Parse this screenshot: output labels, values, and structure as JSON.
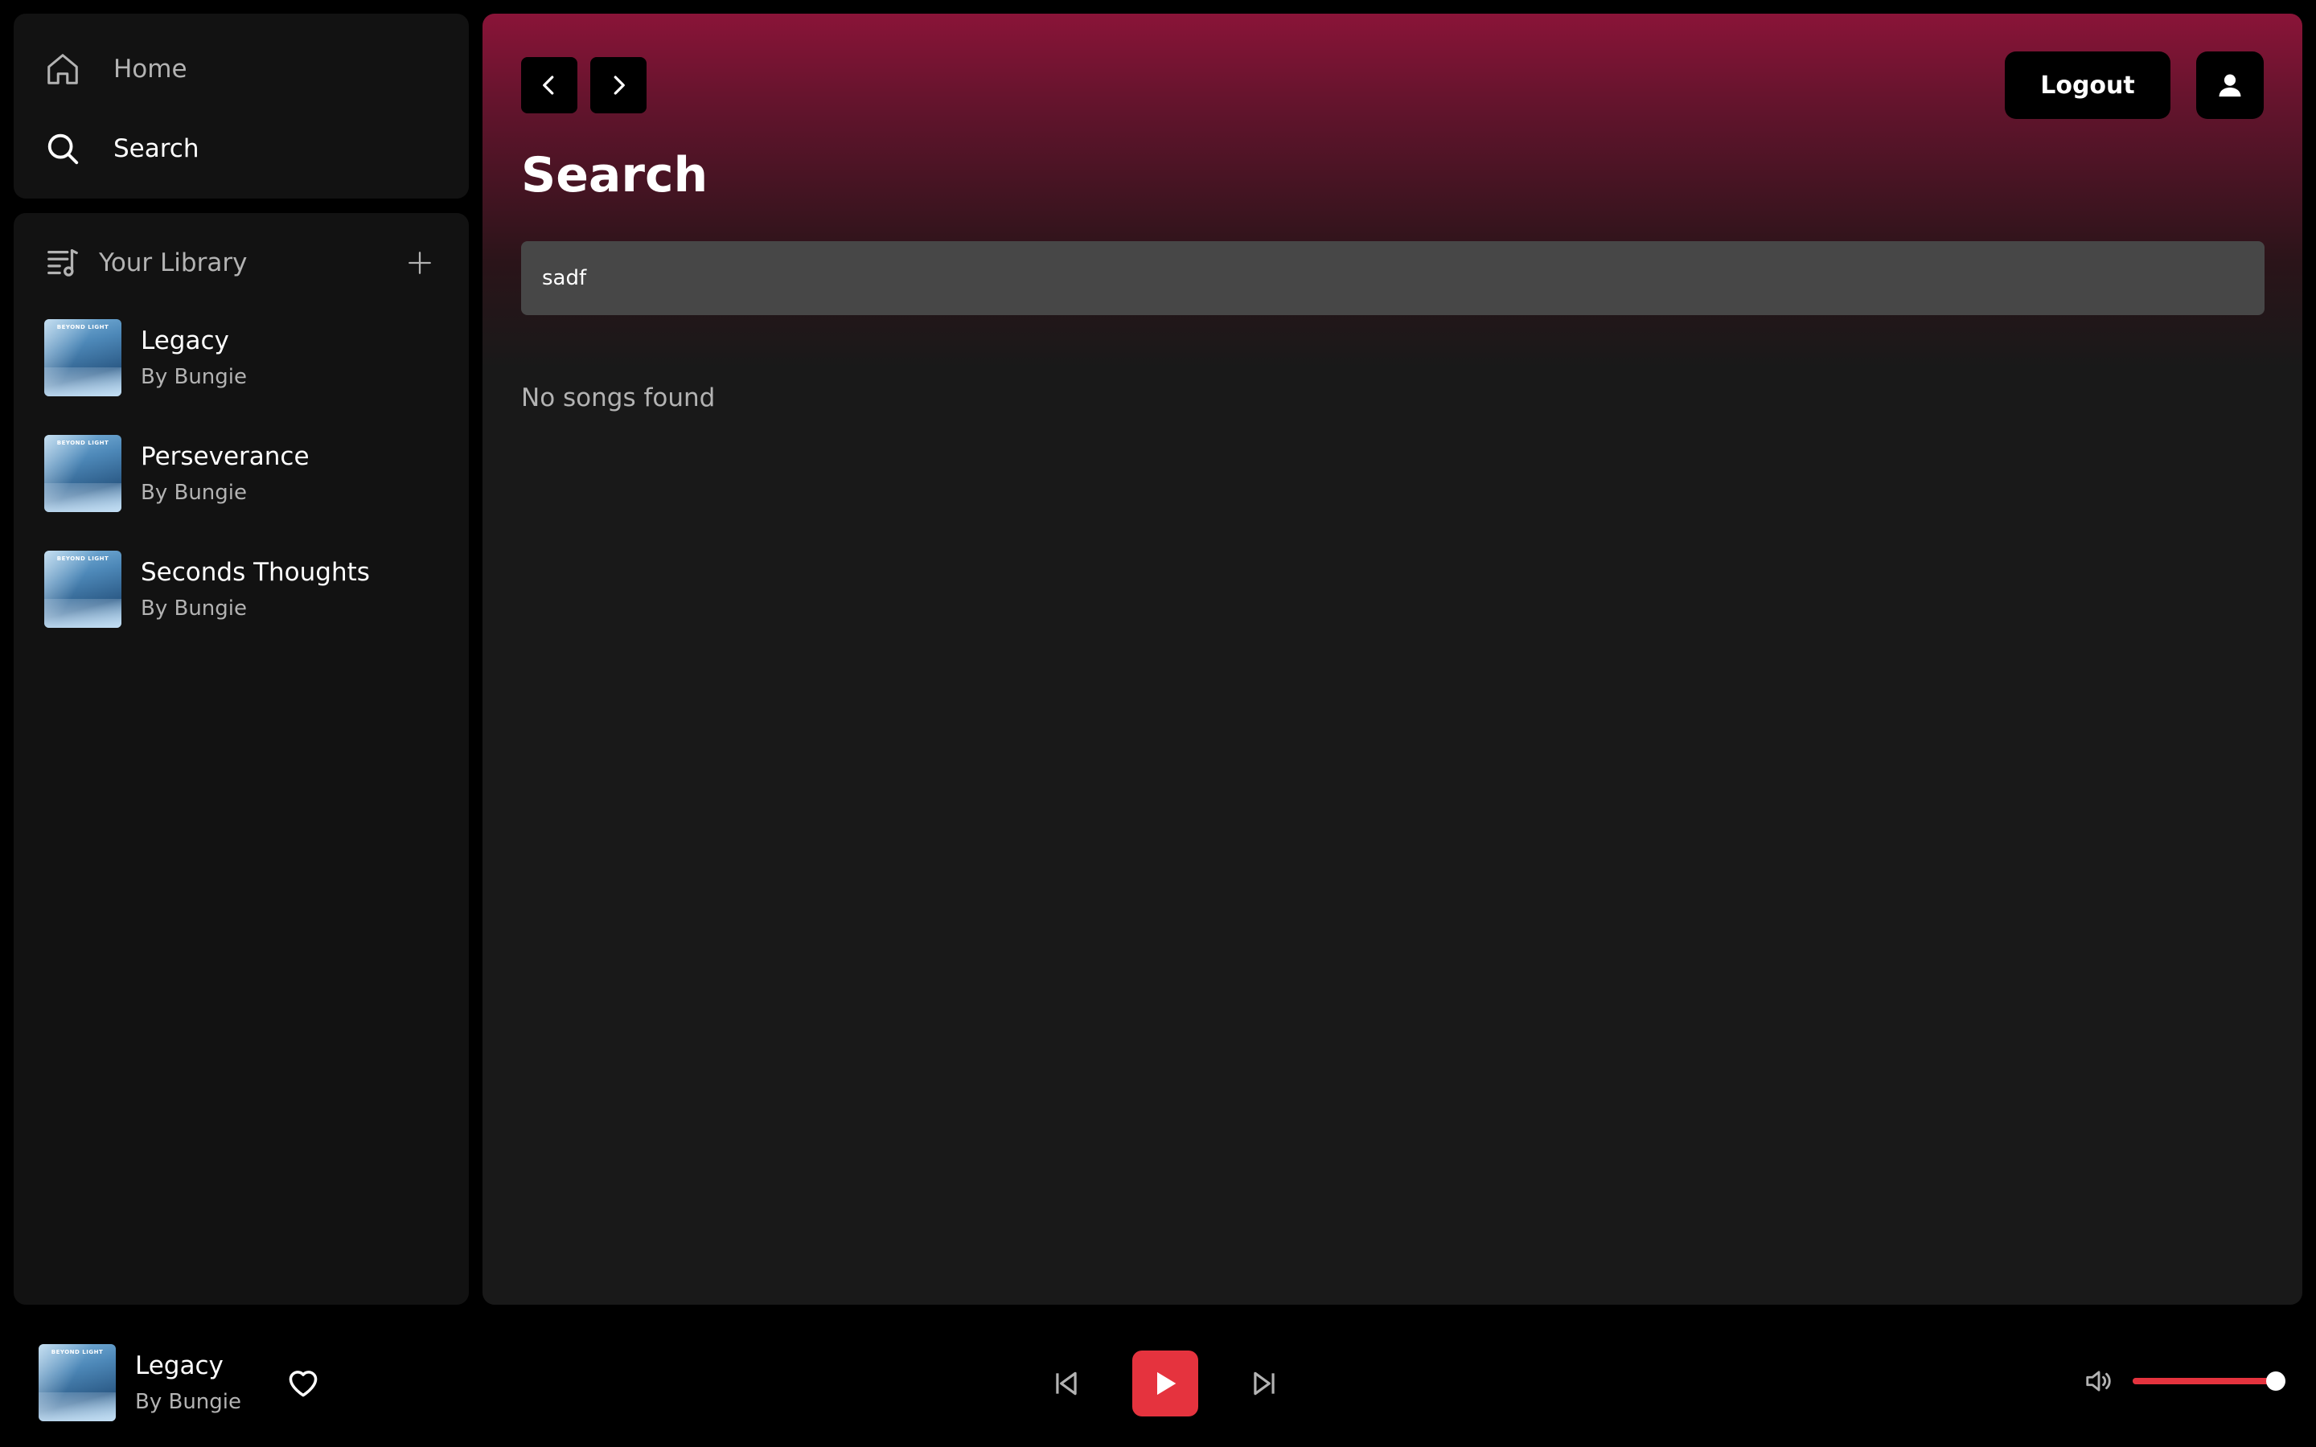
{
  "nav": {
    "home_label": "Home",
    "search_label": "Search"
  },
  "library": {
    "title": "Your Library",
    "cover_text": "BEYOND LIGHT",
    "songs": [
      {
        "title": "Legacy",
        "artist": "By Bungie"
      },
      {
        "title": "Perseverance",
        "artist": "By Bungie"
      },
      {
        "title": "Seconds Thoughts",
        "artist": "By Bungie"
      }
    ]
  },
  "header": {
    "logout_label": "Logout"
  },
  "main": {
    "page_title": "Search",
    "search_value": "sadf",
    "empty_message": "No songs found"
  },
  "player": {
    "title": "Legacy",
    "artist": "By Bungie",
    "volume": 1.0
  },
  "colors": {
    "accent": "#e5333e",
    "header_gradient_top": "#8a1438",
    "panel_bg": "#121212",
    "main_bg": "#191919",
    "input_bg": "#474747"
  }
}
